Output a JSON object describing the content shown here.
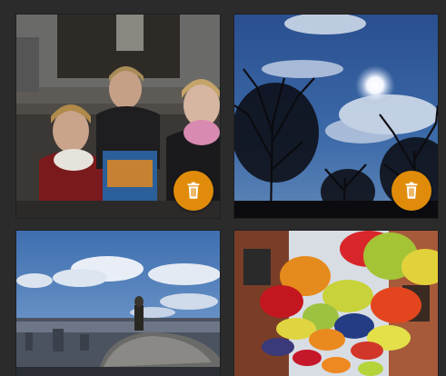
{
  "accent_color": "#e08c0a",
  "background_color": "#2b2b2b",
  "photos": [
    {
      "subject": "children",
      "delete_icon": "trash-icon"
    },
    {
      "subject": "tree-sky",
      "delete_icon": "trash-icon"
    },
    {
      "subject": "rooftop-statue",
      "delete_icon": null
    },
    {
      "subject": "umbrellas",
      "delete_icon": null
    }
  ]
}
